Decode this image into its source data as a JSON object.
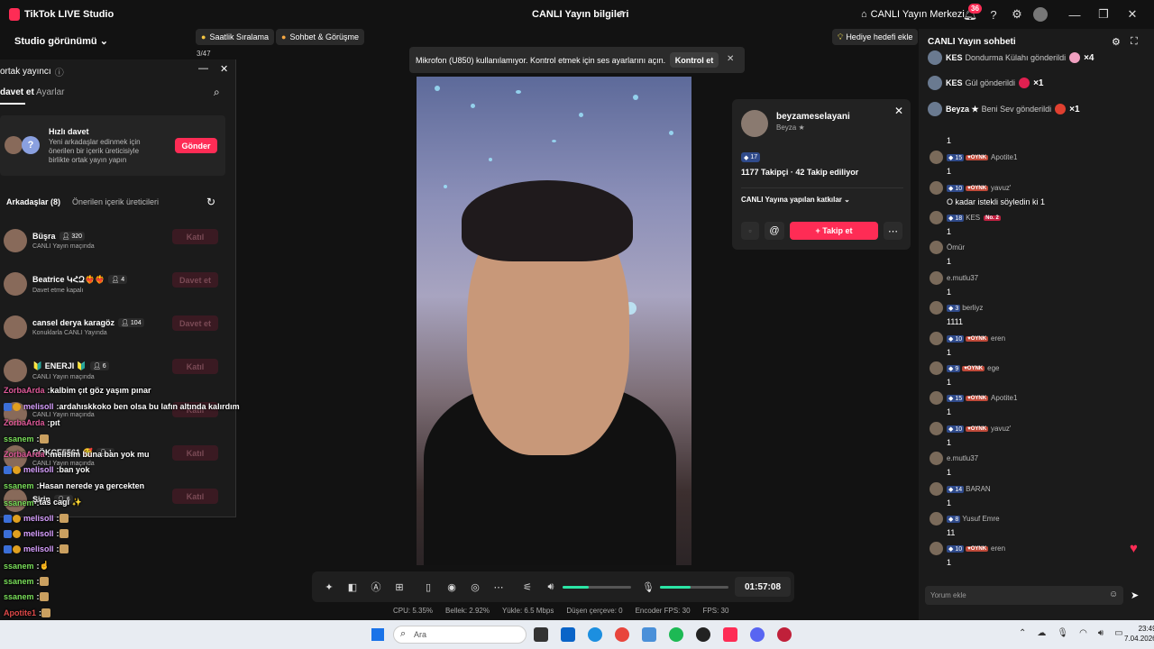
{
  "titlebar": {
    "app_title": "TikTok LIVE Studio",
    "center_title": "CANLI Yayın bilgileri",
    "live_center": "CANLI Yayın Merkezi",
    "notif_count": "36"
  },
  "topbar": {
    "studio_view": "Studio görünümü",
    "pill_hourly": "Saatlik Sıralama",
    "pill_chat": "Sohbet & Görüşme",
    "timer_strip": "3/47",
    "goal": "Hediye hedefi ekle"
  },
  "mic_notice": {
    "text": "Mikrofon (U850) kullanılamıyor. Kontrol etmek için ses ayarlarını açın.",
    "button": "Kontrol et"
  },
  "panel": {
    "title": "ortak yayıncı",
    "tab_invite": "davet et",
    "tab_settings": "Ayarlar",
    "quick_title": "Hızlı davet",
    "quick_desc": "Yeni arkadaşlar edinmek için önerilen bir içerik üreticisiyle birlikte ortak yayın yapın",
    "send": "Gönder",
    "friends_tab": "Arkadaşlar (8)",
    "suggest_tab": "Önerilen içerik üreticileri",
    "friends": [
      {
        "name": "Büşra",
        "count": "320",
        "sub": "CANLI Yayın maçında",
        "btn": "Katıl"
      },
      {
        "name": "Beatrice ԿՀԶ❤️‍🔥❤️‍🔥",
        "count": "4",
        "sub": "Davet etme kapalı",
        "btn": "Davet et"
      },
      {
        "name": "cansel derya karagöz",
        "count": "104",
        "sub": "Konuklarla CANLI Yayında",
        "btn": "Davet et"
      },
      {
        "name": "🔰 ENERJI 🔰",
        "count": "6",
        "sub": "CANLI Yayın maçında",
        "btn": "Katıl"
      },
      {
        "name": "",
        "count": "",
        "sub": "CANLI Yayın maçında",
        "btn": "Katıl"
      },
      {
        "name": "GÖKÇE5561 🥰",
        "count": "1",
        "sub": "CANLI Yayın maçında",
        "btn": "Katıl"
      },
      {
        "name": "Şirin",
        "count": "6",
        "sub": "",
        "btn": "Katıl"
      }
    ]
  },
  "overlay_chat": [
    {
      "name": "ZorbaArda",
      "text": "kalbim çıt göz yaşım pınar",
      "color": "#e05a9a"
    },
    {
      "name": "melisoll",
      "text": "ardahıskkoko ben olsa bu lafın altında kalırdım",
      "color": "#d8a0ff"
    },
    {
      "name": "ZorbaArda",
      "text": "pıt",
      "color": "#e05a9a"
    },
    {
      "name": "ssanem",
      "text": "",
      "color": "#7adf5a"
    },
    {
      "name": "ZorbaArda",
      "text": "melisim buna ban yok mu",
      "color": "#e05a9a"
    },
    {
      "name": "melisoll",
      "text": "ban yok",
      "color": "#d8a0ff"
    },
    {
      "name": "ssanem",
      "text": "Hasan nerede ya gercekten",
      "color": "#7adf5a"
    },
    {
      "name": "ssanem",
      "text": "tas cagi ✨",
      "color": "#7adf5a"
    },
    {
      "name": "melisoll",
      "text": "",
      "color": "#d8a0ff"
    },
    {
      "name": "melisoll",
      "text": "",
      "color": "#d8a0ff"
    },
    {
      "name": "melisoll",
      "text": "",
      "color": "#d8a0ff"
    },
    {
      "name": "ssanem",
      "text": "☝️",
      "color": "#7adf5a"
    },
    {
      "name": "ssanem",
      "text": "",
      "color": "#7adf5a"
    },
    {
      "name": "ssanem",
      "text": "",
      "color": "#7adf5a"
    },
    {
      "name": "Apotite1",
      "text": "",
      "color": "#e04a4a"
    }
  ],
  "profile": {
    "username": "beyzameselayani",
    "display": "Beyza ★",
    "level": "17",
    "stats": "1177 Takipçi · 42 Takip ediliyor",
    "contrib": "CANLI Yayına yapılan katkılar",
    "follow": "+ Takip et"
  },
  "chat": {
    "title": "CANLI Yayın sohbeti",
    "input_placeholder": "Yorum ekle",
    "gifts": [
      {
        "name": "KES",
        "text": "Dondurma Külahı gönderildi",
        "x": "×4",
        "color": "#f0a0c0"
      },
      {
        "name": "KES",
        "text": "Gül gönderildi",
        "x": "×1",
        "color": "#e02050"
      },
      {
        "name": "Beyza ★",
        "text": "Beni Sev gönderildi",
        "x": "×1",
        "color": "#e04030"
      }
    ],
    "messages": [
      {
        "level": "",
        "tag": "",
        "user": "",
        "text": "1"
      },
      {
        "level": "15",
        "tag": "OYNK",
        "user": "Apotite1",
        "text": "1"
      },
      {
        "level": "10",
        "tag": "OYNK",
        "user": "yavuz'",
        "text": "O kadar istekli söyledin ki 1"
      },
      {
        "level": "18",
        "tag": "",
        "user": "KES",
        "text": "1",
        "extra": "No. 2"
      },
      {
        "level": "",
        "tag": "",
        "user": "Ömür",
        "text": "1"
      },
      {
        "level": "",
        "tag": "",
        "user": "e.mutlu37",
        "text": "1"
      },
      {
        "level": "3",
        "tag": "",
        "user": "berliyz",
        "text": "1111"
      },
      {
        "level": "10",
        "tag": "OYNK",
        "user": "eren",
        "text": "1"
      },
      {
        "level": "9",
        "tag": "OYNK",
        "user": "ege",
        "text": "1"
      },
      {
        "level": "15",
        "tag": "OYNK",
        "user": "Apotite1",
        "text": "1"
      },
      {
        "level": "10",
        "tag": "OYNK",
        "user": "yavuz'",
        "text": "1"
      },
      {
        "level": "",
        "tag": "",
        "user": "e.mutlu37",
        "text": "1"
      },
      {
        "level": "14",
        "tag": "",
        "user": "BARAN",
        "text": "1"
      },
      {
        "level": "8",
        "tag": "",
        "user": "Yusuf Emre",
        "text": "11"
      },
      {
        "level": "10",
        "tag": "OYNK",
        "user": "eren",
        "text": "1"
      }
    ]
  },
  "controls": {
    "timer": "01:57:08",
    "mic_level": 0.45,
    "speaker_level": 0.38
  },
  "stats": {
    "cpu": "CPU: 5.35%",
    "mem": "Bellek: 2.92%",
    "upload": "Yükle: 6.5 Mbps",
    "dropped": "Düşen çerçeve: 0",
    "enc": "Encoder FPS: 30",
    "fps": "FPS: 30"
  },
  "taskbar": {
    "search": "Ara",
    "time": "23:49",
    "date": "7.04.2026"
  }
}
